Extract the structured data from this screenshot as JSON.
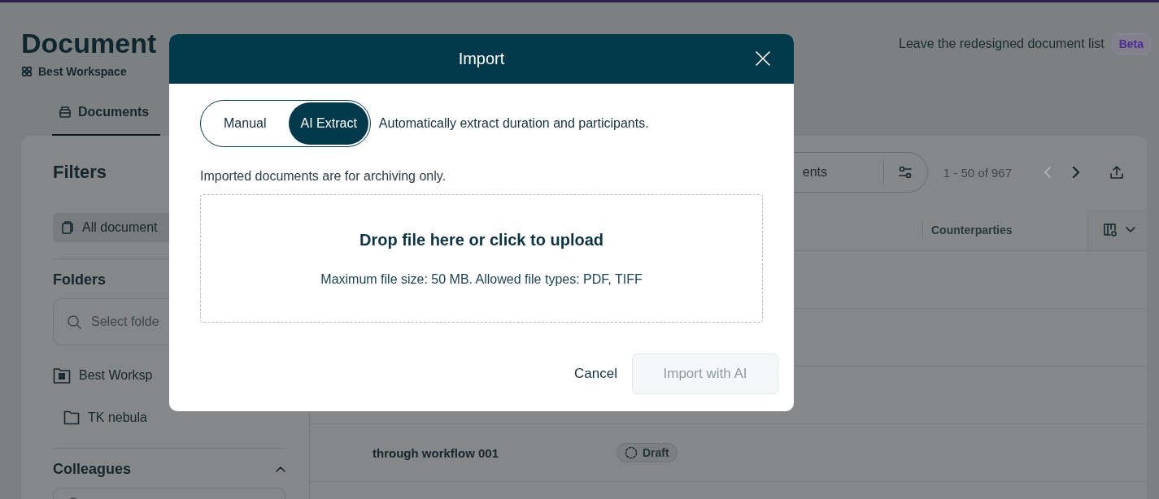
{
  "page": {
    "title": "Document",
    "workspace": "Best Workspace",
    "banner_link": "Leave the redesigned document list",
    "badge": "Beta"
  },
  "tabs": [
    {
      "label": "Documents",
      "selected": true
    }
  ],
  "filters": {
    "title": "Filters",
    "items": [
      {
        "label": "All document",
        "selected": true
      }
    ],
    "folders": {
      "title": "Folders",
      "placeholder": "Select folde",
      "tree": [
        {
          "label": "Best Worksp",
          "kind": "workspace",
          "children": [
            {
              "label": "TK nebula",
              "kind": "folder"
            }
          ]
        }
      ]
    },
    "colleagues": {
      "title": "Colleagues",
      "expanded": true
    }
  },
  "toolbar": {
    "placeholder": "ents",
    "range": "1 - 50 of 967",
    "pager": [
      {
        "kind": "prev",
        "disabled": true
      },
      {
        "kind": "next",
        "disabled": false
      }
    ]
  },
  "table": {
    "columns": [
      "Counterparties"
    ],
    "rows": [
      {
        "title": "through workflow 001",
        "status": "Draft"
      }
    ]
  },
  "modal": {
    "title": "Import",
    "modes": [
      {
        "label": "Manual",
        "selected": false
      },
      {
        "label": "AI Extract",
        "selected": true
      }
    ],
    "mode_description": "Automatically extract duration and participants.",
    "note": "Imported documents are for archiving only.",
    "dropzone": {
      "title": "Drop file here or click to upload",
      "hint": "Maximum file size: 50 MB. Allowed file types: PDF, TIFF"
    },
    "cancel": "Cancel",
    "primary": {
      "label": "Import with AI",
      "disabled": true
    }
  }
}
